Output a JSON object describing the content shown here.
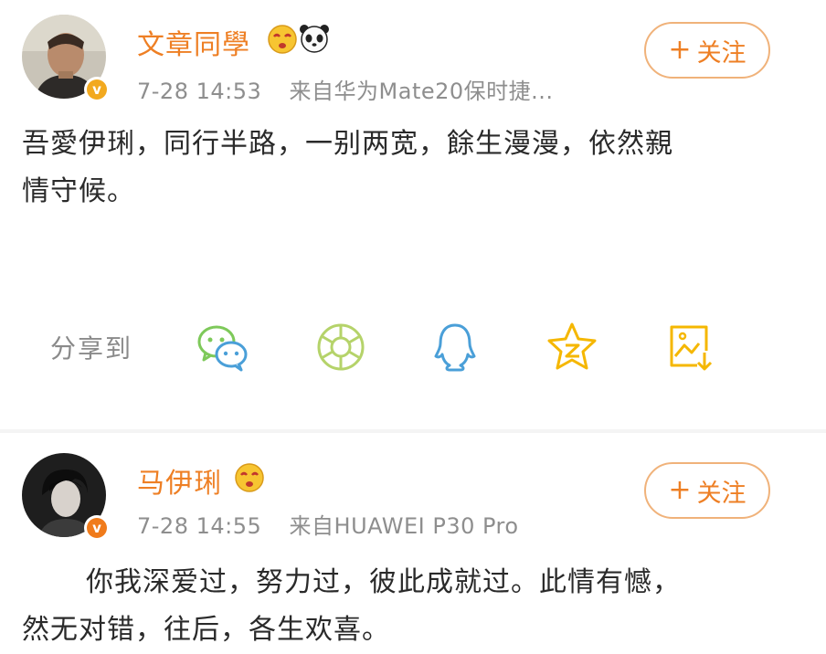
{
  "posts": [
    {
      "username": "文章同學",
      "time": "7-28 14:53",
      "source": "来自华为Mate20保时捷...",
      "follow_label": "关注",
      "content_line1": "吾愛伊琍，同行半路，一别两宽，餘生漫漫，依然親",
      "content_line2": "情守候。"
    },
    {
      "username": "马伊琍",
      "time": "7-28 14:55",
      "source": "来自HUAWEI P30 Pro",
      "follow_label": "关注",
      "content_line1": "你我深爱过，努力过，彼此成就过。此情有憾，",
      "content_line2": "然无对错，往后，各生欢喜。"
    }
  ],
  "share": {
    "label": "分享到",
    "targets": [
      "wechat-icon",
      "moments-icon",
      "qq-icon",
      "qzone-icon",
      "save-image-icon"
    ]
  },
  "colors": {
    "accent": "#ee7f24",
    "follow_border": "#f0b27a",
    "verified_badge": "#f2a91f",
    "meta_text": "#8e8e8e",
    "share_green": "#7ec95a",
    "share_blue": "#4a9fd8",
    "share_yellow": "#f5b700"
  }
}
